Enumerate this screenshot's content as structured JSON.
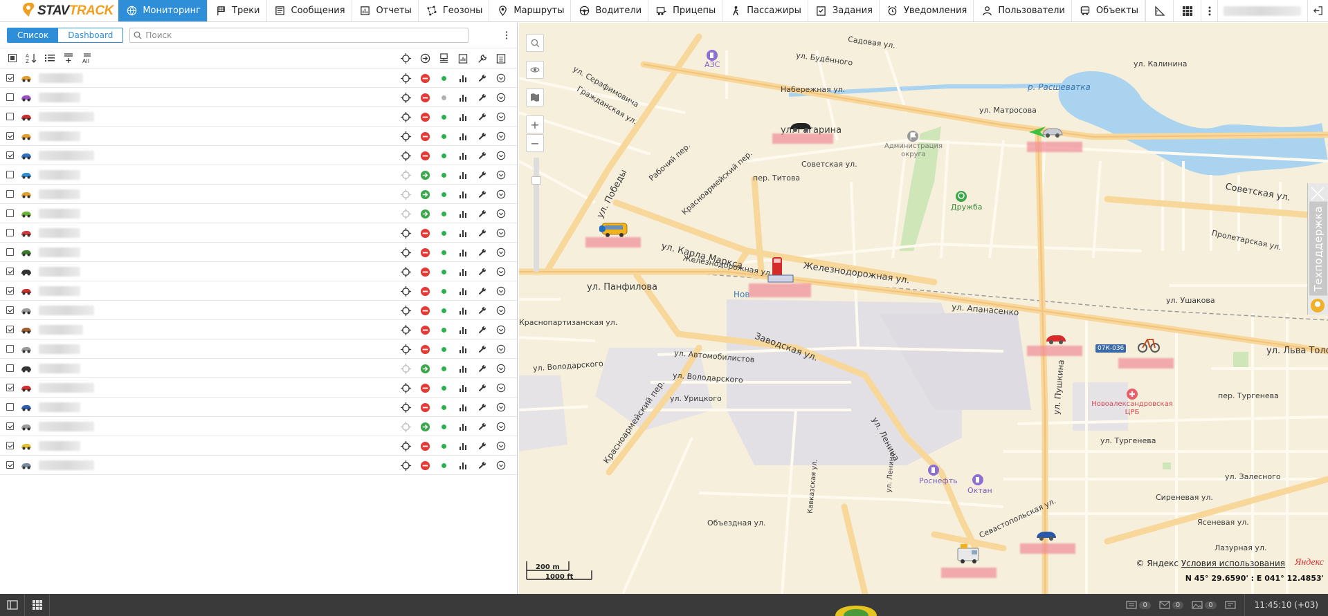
{
  "app": {
    "brand_part1": "STAV",
    "brand_part2": "TRACK"
  },
  "nav": [
    {
      "label": "Мониторинг",
      "icon": "globe-icon",
      "active": true
    },
    {
      "label": "Треки",
      "icon": "flag-icon"
    },
    {
      "label": "Сообщения",
      "icon": "messages-icon"
    },
    {
      "label": "Отчеты",
      "icon": "report-icon"
    },
    {
      "label": "Геозоны",
      "icon": "geofence-icon"
    },
    {
      "label": "Маршруты",
      "icon": "route-icon"
    },
    {
      "label": "Водители",
      "icon": "driver-icon"
    },
    {
      "label": "Прицепы",
      "icon": "trailer-icon"
    },
    {
      "label": "Пассажиры",
      "icon": "passenger-icon"
    },
    {
      "label": "Задания",
      "icon": "task-icon"
    },
    {
      "label": "Уведомления",
      "icon": "alarm-icon"
    },
    {
      "label": "Пользователи",
      "icon": "user-icon"
    },
    {
      "label": "Объекты",
      "icon": "bus-icon"
    }
  ],
  "left_panel": {
    "tab_list": "Список",
    "tab_dashboard": "Dashboard",
    "search_placeholder": "Поиск",
    "all_label": "All"
  },
  "units": [
    {
      "checked": true,
      "color": "#e0a030",
      "conn": "#e53935",
      "status": "#2cb24a"
    },
    {
      "checked": false,
      "color": "#9b4fc4",
      "conn": "#e53935",
      "status": "#b0b0b0"
    },
    {
      "checked": false,
      "color": "#c83030",
      "conn": "#e53935",
      "status": "#2cb24a"
    },
    {
      "checked": true,
      "color": "#e0a030",
      "conn": "#e53935",
      "status": "#2cb24a"
    },
    {
      "checked": true,
      "color": "#2f6fc2",
      "conn": "#e53935",
      "status": "#2cb24a"
    },
    {
      "checked": false,
      "color": "#2f8fd0",
      "conn": "#3aa84a",
      "status": "#2cb24a"
    },
    {
      "checked": false,
      "color": "#e0a030",
      "conn": "#3aa84a",
      "status": "#2cb24a"
    },
    {
      "checked": false,
      "color": "#6cb23a",
      "conn": "#3aa84a",
      "status": "#2cb24a"
    },
    {
      "checked": false,
      "color": "#d03a3a",
      "conn": "#e53935",
      "status": "#2cb24a"
    },
    {
      "checked": false,
      "color": "#3b7a2a",
      "conn": "#e53935",
      "status": "#2cb24a"
    },
    {
      "checked": true,
      "color": "#333333",
      "conn": "#e53935",
      "status": "#2cb24a"
    },
    {
      "checked": true,
      "color": "#c83030",
      "conn": "#e53935",
      "status": "#2cb24a"
    },
    {
      "checked": true,
      "color": "#9a9a9a",
      "conn": "#e53935",
      "status": "#2cb24a"
    },
    {
      "checked": true,
      "color": "#a06030",
      "conn": "#e53935",
      "status": "#2cb24a"
    },
    {
      "checked": false,
      "color": "#9a9a9a",
      "conn": "#e53935",
      "status": "#2cb24a"
    },
    {
      "checked": false,
      "color": "#333333",
      "conn": "#3aa84a",
      "status": "#2cb24a"
    },
    {
      "checked": true,
      "color": "#d03030",
      "conn": "#e53935",
      "status": "#2cb24a"
    },
    {
      "checked": false,
      "color": "#2f5fb0",
      "conn": "#e53935",
      "status": "#2cb24a"
    },
    {
      "checked": true,
      "color": "#9a9a9a",
      "conn": "#3aa84a",
      "status": "#2cb24a"
    },
    {
      "checked": true,
      "color": "#e0c030",
      "conn": "#e53935",
      "status": "#2cb24a"
    },
    {
      "checked": true,
      "color": "#7a8aa0",
      "conn": "#e53935",
      "status": "#2cb24a"
    }
  ],
  "map": {
    "streets": {
      "gagarina": "ул. Гагарина",
      "pobedy": "ул. Победы",
      "karla_marksa": "ул. Карла Маркса",
      "zheleznodorozhnaya": "Железнодорожная ул.",
      "zheleznodorozhnaya2": "Железнодорожная ул.",
      "panfilova": "ул. Панфилова",
      "zavodskaya": "Заводская ул.",
      "krasnoarmeyskiy": "Красноармейский пер.",
      "lenina": "ул. Ленина",
      "pushkina": "ул. Пушкина",
      "sovetskaya": "Советская ул.",
      "sovetskaya2": "Советская ул.",
      "apanasenko": "ул. Апанасенко",
      "lva_tolstogo": "ул. Льва Толс",
      "turgeneva": "пер. Тургенева",
      "turgeneva2": "ул. Тургенева",
      "avtomobilistov": "ул. Автомобилистов",
      "volodarskogo": "ул. Володарского",
      "volodarskogo2": "ул. Володарского",
      "uritskogo": "ул. Урицкого",
      "obezdnaya": "Объездная ул.",
      "rasshevatka": "р. Расшеватка",
      "matrosova": "ул. Матросова",
      "kalinina": "ул. Калинина",
      "naberezhnaya": "Набережная ул.",
      "budennogo": "ул. Будённого",
      "sadovaya": "Садовая ул.",
      "serafimovicha": "ул. Серафимовича",
      "grazhdanskaya": "Гражданская ул.",
      "titova": "пер. Титова",
      "rabochiy": "Рабочий пер.",
      "krasnoarm_per": "Красноармейский пер.",
      "zheleznodorozh_small": "Железнодорожная ул.",
      "ushakova": "ул. Ушакова",
      "proletarskaya": "Пролетарская ул.",
      "kavkazskaya": "Кавказская ул.",
      "sevastopolskaya": "Севастопольская ул.",
      "zalesnogo": "ул. Залесного",
      "sirenevaya": "Сиреневая ул.",
      "yasenevaya": "Ясеневая ул.",
      "lazurnaya": "Лазурная ул.",
      "krasnopartizanskaya": "Краснопартизанская ул.",
      "lenina_small": "ул. Ленина",
      "druzhba": "Дружба",
      "azs": "АЗС",
      "admin": "Администрация округа",
      "rosneft": "Роснефть",
      "oktan": "Октан",
      "hospital": "Новоалександровская ЦРБ",
      "road_sign": "07К-036",
      "nov": "Нов"
    },
    "support": "Техподдержка",
    "scale_m": "200 m",
    "scale_ft": "1000 ft",
    "copyright": "© Яндекс",
    "terms": "Условия использования",
    "yandex": "Яндекс",
    "coords": "N 45° 29.6590' : E 041° 12.4853'"
  },
  "bottom": {
    "counter1": "0",
    "counter2": "0",
    "counter3": "0",
    "time": "11:45:10 (+03)"
  }
}
